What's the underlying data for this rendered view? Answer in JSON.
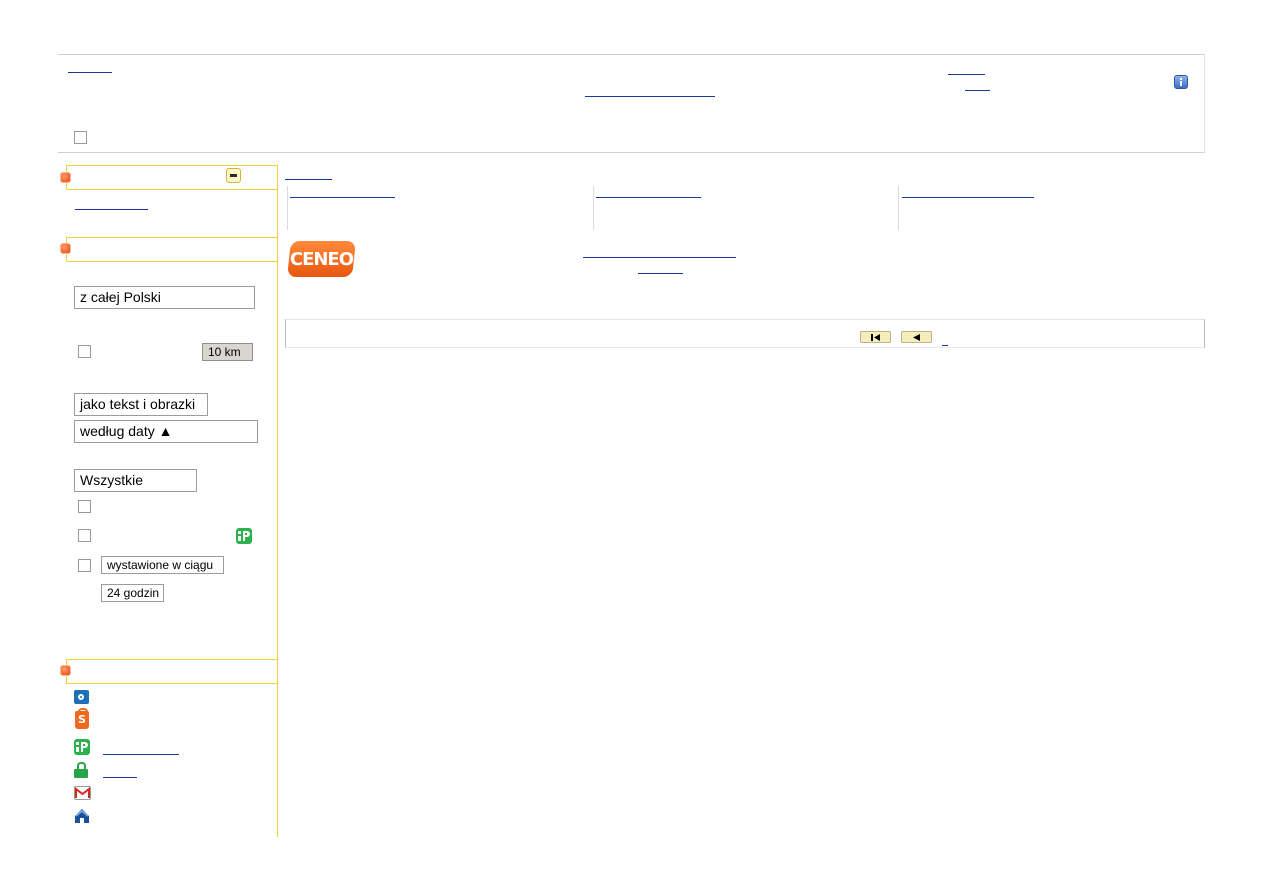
{
  "location_select": {
    "value": "z całej Polski"
  },
  "distance_select": {
    "value": "10 km"
  },
  "view_select": {
    "value": "jako tekst i obrazki"
  },
  "sort_select": {
    "value": "według daty ▲"
  },
  "offer_type_select": {
    "value": "Wszystkie"
  },
  "time_select": {
    "value": "wystawione w ciągu"
  },
  "time_period_select": {
    "value": "24 godzin"
  },
  "ceneo_logo": {
    "text": "CENEO"
  },
  "colors": {
    "accent_border": "#f0d23a",
    "header_bg": "#ffffff",
    "pager_bg": "#f6eeb8",
    "ceneo_orange": "#f26a1b"
  },
  "icons": [
    "info-icon",
    "collapse-icon",
    "camera-icon",
    "shopping-bag-icon",
    "payu-icon",
    "lock-icon",
    "gmail-icon",
    "home-icon",
    "first-page-icon",
    "prev-page-icon"
  ]
}
